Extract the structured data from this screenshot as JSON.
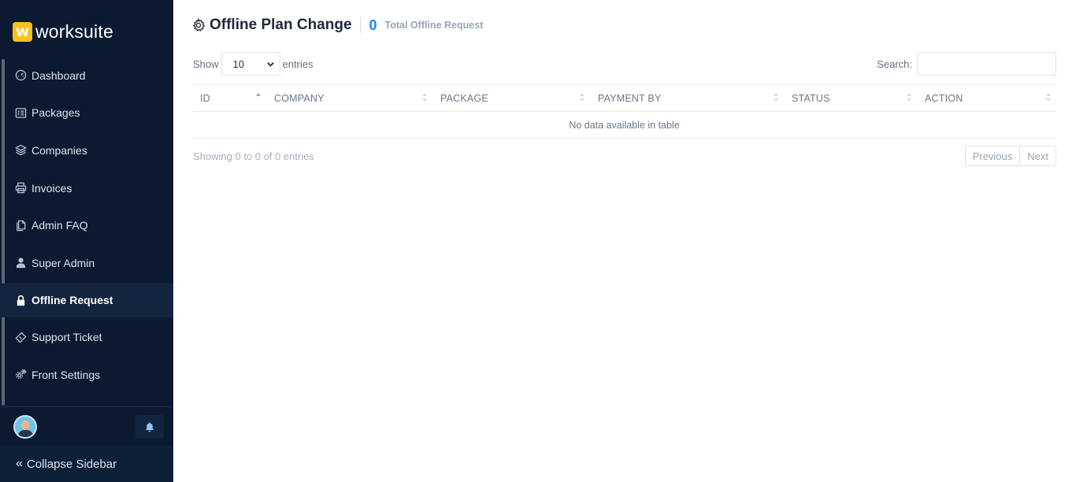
{
  "brand": {
    "mark": "w",
    "name": "worksuite",
    "mark_color": "#f9c21c"
  },
  "sidebar": {
    "items": [
      {
        "label": "Dashboard",
        "icon": "dashboard-icon"
      },
      {
        "label": "Packages",
        "icon": "packages-icon"
      },
      {
        "label": "Companies",
        "icon": "layers-icon"
      },
      {
        "label": "Invoices",
        "icon": "printer-icon"
      },
      {
        "label": "Admin FAQ",
        "icon": "document-icon"
      },
      {
        "label": "Super Admin",
        "icon": "user-icon"
      },
      {
        "label": "Offline Request",
        "icon": "lock-icon",
        "active": true
      },
      {
        "label": "Support Ticket",
        "icon": "ticket-icon"
      },
      {
        "label": "Front Settings",
        "icon": "gears-icon"
      }
    ],
    "collapse_label": "Collapse Sidebar",
    "collapse_icon": "double-chevron-left-icon",
    "background": "#0b1a31"
  },
  "header": {
    "title": "Offline Plan Change",
    "count": "0",
    "count_label": "Total Offline Request",
    "accent": "#1d82f5"
  },
  "controls": {
    "show_label": "Show",
    "entries_value": "10",
    "entries_label": "entries",
    "search_label": "Search:",
    "search_value": ""
  },
  "table": {
    "columns": [
      "ID",
      "COMPANY",
      "PACKAGE",
      "PAYMENT BY",
      "STATUS",
      "ACTION"
    ],
    "empty_text": "No data available in table"
  },
  "footer": {
    "info": "Showing 0 to 0 of 0 entries",
    "previous": "Previous",
    "next": "Next"
  }
}
